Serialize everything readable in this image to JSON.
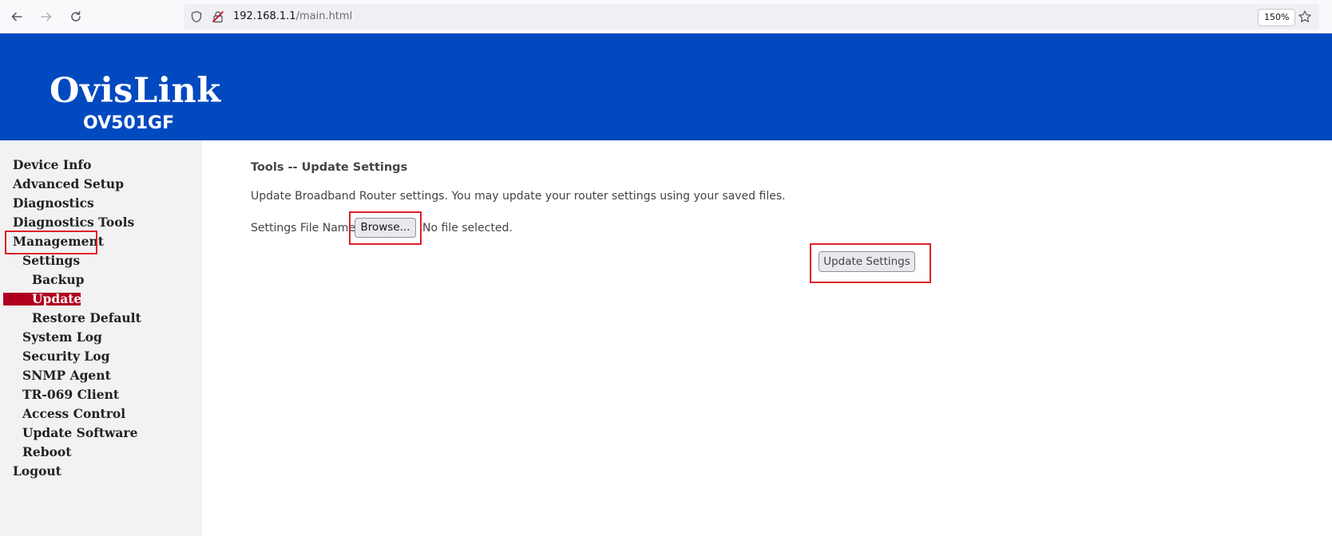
{
  "browser": {
    "url_host": "192.168.1.1",
    "url_path": "/main.html",
    "zoom": "150%"
  },
  "banner": {
    "logo_text": "OvisLink",
    "model": "OV501GF"
  },
  "sidebar": {
    "items": [
      {
        "label": "Device Info"
      },
      {
        "label": "Advanced Setup"
      },
      {
        "label": "Diagnostics"
      },
      {
        "label": "Diagnostics Tools"
      },
      {
        "label": "Management"
      },
      {
        "label": "Settings"
      },
      {
        "label": "Backup"
      },
      {
        "label": "Update"
      },
      {
        "label": "Restore Default"
      },
      {
        "label": "System Log"
      },
      {
        "label": "Security Log"
      },
      {
        "label": "SNMP Agent"
      },
      {
        "label": "TR-069 Client"
      },
      {
        "label": "Access Control"
      },
      {
        "label": "Update Software"
      },
      {
        "label": "Reboot"
      },
      {
        "label": "Logout"
      }
    ],
    "active_item": "Update",
    "active_color": "#b0001e"
  },
  "main": {
    "title": "Tools -- Update Settings",
    "description": "Update Broadband Router settings. You may update your router settings using your saved files.",
    "file_label": "Settings File Name",
    "browse_label": "Browse...",
    "no_file_text": "No file selected.",
    "update_button": "Update Settings"
  },
  "colors": {
    "banner": "#0049bf",
    "highlight": "#e0202a"
  },
  "icons": [
    "back-arrow-icon",
    "forward-arrow-icon",
    "reload-icon",
    "shield-icon",
    "insecure-lock-icon",
    "bookmark-star-icon"
  ]
}
